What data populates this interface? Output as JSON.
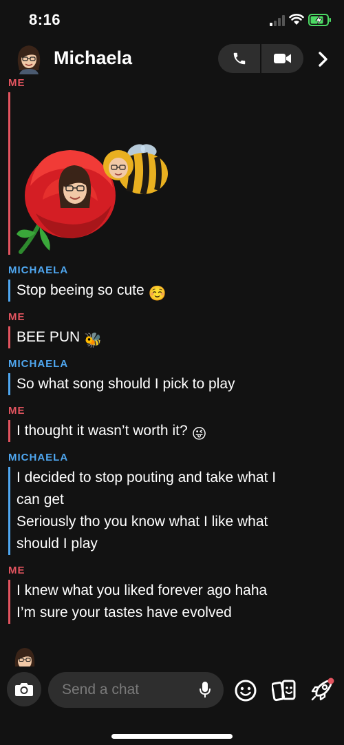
{
  "status_bar": {
    "time": "8:16"
  },
  "header": {
    "name": "Michaela",
    "call_icon": "phone-icon",
    "video_icon": "video-camera-icon",
    "next_icon": "chevron-right-icon"
  },
  "colors": {
    "me": "#e2545f",
    "them": "#4fa7f0",
    "background": "#121212",
    "control_background": "#2e2e2e"
  },
  "messages": [
    {
      "sender": "ME",
      "type": "sticker",
      "sticker": "bitmoji-rose-and-bee-sticker"
    },
    {
      "sender": "MICHAELA",
      "lines": [
        "Stop beeing so cute"
      ],
      "emoji": "☺️"
    },
    {
      "sender": "ME",
      "lines": [
        "BEE PUN"
      ],
      "emoji": "🐝"
    },
    {
      "sender": "MICHAELA",
      "lines": [
        "So what song should I pick to play"
      ]
    },
    {
      "sender": "ME",
      "lines": [
        "I thought it wasn’t worth it?"
      ],
      "emoji": "😜"
    },
    {
      "sender": "MICHAELA",
      "lines": [
        "I decided to stop pouting and take what I",
        "can get",
        "Seriously tho you know what I like what",
        "should I play"
      ]
    },
    {
      "sender": "ME",
      "lines": [
        "I knew what you liked forever ago haha",
        "I’m sure your tastes have evolved"
      ]
    }
  ],
  "input_bar": {
    "placeholder": "Send a chat",
    "camera_icon": "camera-icon",
    "mic_icon": "microphone-icon",
    "smile_icon": "smiley-icon",
    "sticker_icon": "sticker-icon",
    "games_icon": "rocket-icon"
  }
}
